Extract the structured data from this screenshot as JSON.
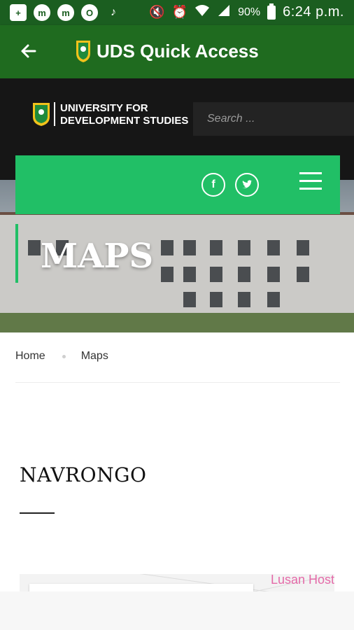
{
  "status_bar": {
    "left_icons": [
      "plus-box-icon",
      "messenger-icon",
      "messenger-icon",
      "opera-icon",
      "tiktok-icon"
    ],
    "right_icons": [
      "mute-icon",
      "alarm-icon",
      "wifi-icon",
      "signal-icon",
      "battery-icon"
    ],
    "battery": "90%",
    "time": "6:24 p.m."
  },
  "app_bar": {
    "title": "UDS Quick Access",
    "back_icon": "arrow-left-icon",
    "color": "#1f6b1f"
  },
  "site_header": {
    "uds_name_line1": "UNIVERSITY FOR",
    "uds_name_line2": "DEVELOPMENT STUDIES",
    "search_placeholder": "Search ..."
  },
  "nav": {
    "accent_color": "#21bf66",
    "social": [
      {
        "icon": "facebook-icon",
        "glyph": "f"
      },
      {
        "icon": "twitter-icon",
        "glyph": "t"
      }
    ],
    "menu_icon": "hamburger-icon"
  },
  "hero": {
    "title": "MAPS"
  },
  "breadcrumb": {
    "home": "Home",
    "current": "Maps"
  },
  "section": {
    "title": "NAVRONGO"
  },
  "map": {
    "label": "Lusan Host"
  }
}
